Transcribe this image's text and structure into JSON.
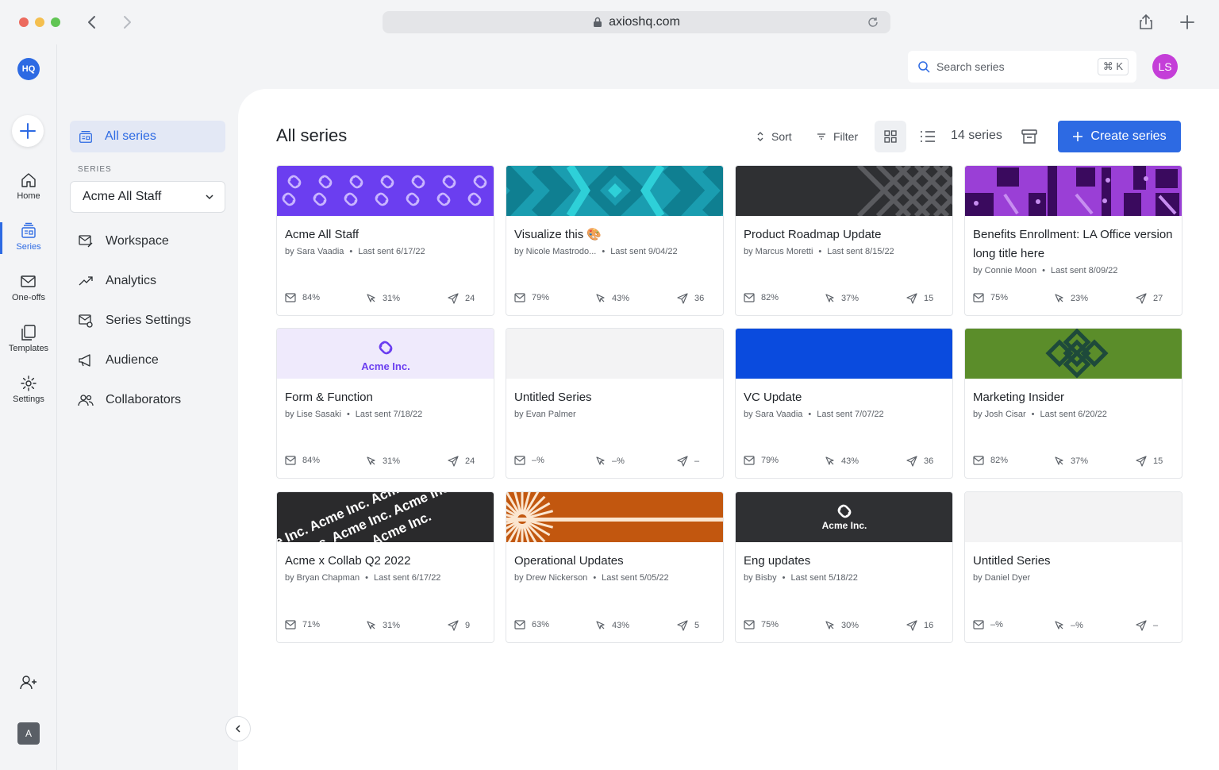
{
  "browser": {
    "url": "axioshq.com"
  },
  "rail": {
    "logo": "HQ",
    "items": [
      {
        "label": "Home"
      },
      {
        "label": "Series"
      },
      {
        "label": "One-offs"
      },
      {
        "label": "Templates"
      },
      {
        "label": "Settings"
      }
    ],
    "account_initial": "A"
  },
  "sidebar": {
    "all_series": "All series",
    "section_label": "SERIES",
    "selected_series": "Acme All Staff",
    "links": [
      "Workspace",
      "Analytics",
      "Series Settings",
      "Audience",
      "Collaborators"
    ]
  },
  "topbar": {
    "search_placeholder": "Search series",
    "shortcut": "⌘ K",
    "user_initials": "LS"
  },
  "main": {
    "title": "All series",
    "sort_label": "Sort",
    "filter_label": "Filter",
    "count_label": "14 series",
    "create_label": "Create series"
  },
  "colors": {
    "accent": "#2d6ae3",
    "avatar": "#c43ed8"
  },
  "cards": [
    {
      "title": "Acme All Staff",
      "author": "by Sara Vaadia",
      "last_sent": "Last sent 6/17/22",
      "open": "84%",
      "click": "31%",
      "sent": "24",
      "banner": "purple-swirl"
    },
    {
      "title": "Visualize this 🎨",
      "author": "by Nicole Mastrodo...",
      "last_sent": "Last sent 9/04/22",
      "open": "79%",
      "click": "43%",
      "sent": "36",
      "banner": "teal-diamond"
    },
    {
      "title": "Product Roadmap Update",
      "author": "by Marcus Moretti",
      "last_sent": "Last sent 8/15/22",
      "open": "82%",
      "click": "37%",
      "sent": "15",
      "banner": "dark-lattice"
    },
    {
      "title": "Benefits Enrollment: LA Office version long title here",
      "author": "by Connie Moon",
      "last_sent": "Last sent 8/09/22",
      "open": "75%",
      "click": "23%",
      "sent": "27",
      "banner": "purple-blocks"
    },
    {
      "title": "Form & Function",
      "author": "by Lise Sasaki",
      "last_sent": "Last sent 7/18/22",
      "open": "84%",
      "click": "31%",
      "sent": "24",
      "banner": "acme-light",
      "banner_text": "Acme Inc."
    },
    {
      "title": "Untitled Series",
      "author": "by Evan Palmer",
      "last_sent": "",
      "open": "–%",
      "click": "–%",
      "sent": "–",
      "banner": "blank"
    },
    {
      "title": "VC Update",
      "author": "by Sara Vaadia",
      "last_sent": "Last sent 7/07/22",
      "open": "79%",
      "click": "43%",
      "sent": "36",
      "banner": "blue"
    },
    {
      "title": "Marketing Insider",
      "author": "by Josh Cisar",
      "last_sent": "Last sent 6/20/22",
      "open": "82%",
      "click": "37%",
      "sent": "15",
      "banner": "green-knot"
    },
    {
      "title": "Acme x Collab Q2 2022",
      "author": "by Bryan Chapman",
      "last_sent": "Last sent 6/17/22",
      "open": "71%",
      "click": "31%",
      "sent": "9",
      "banner": "acme-diagonal",
      "banner_text": "Acme Inc."
    },
    {
      "title": "Operational Updates",
      "author": "by Drew Nickerson",
      "last_sent": "Last sent 5/05/22",
      "open": "63%",
      "click": "43%",
      "sent": "5",
      "banner": "orange-sun"
    },
    {
      "title": "Eng updates",
      "author": "by Bisby",
      "last_sent": "Last sent 5/18/22",
      "open": "75%",
      "click": "30%",
      "sent": "16",
      "banner": "acme-dark",
      "banner_text": "Acme Inc."
    },
    {
      "title": "Untitled Series",
      "author": "by Daniel Dyer",
      "last_sent": "",
      "open": "–%",
      "click": "–%",
      "sent": "–",
      "banner": "blank"
    }
  ]
}
